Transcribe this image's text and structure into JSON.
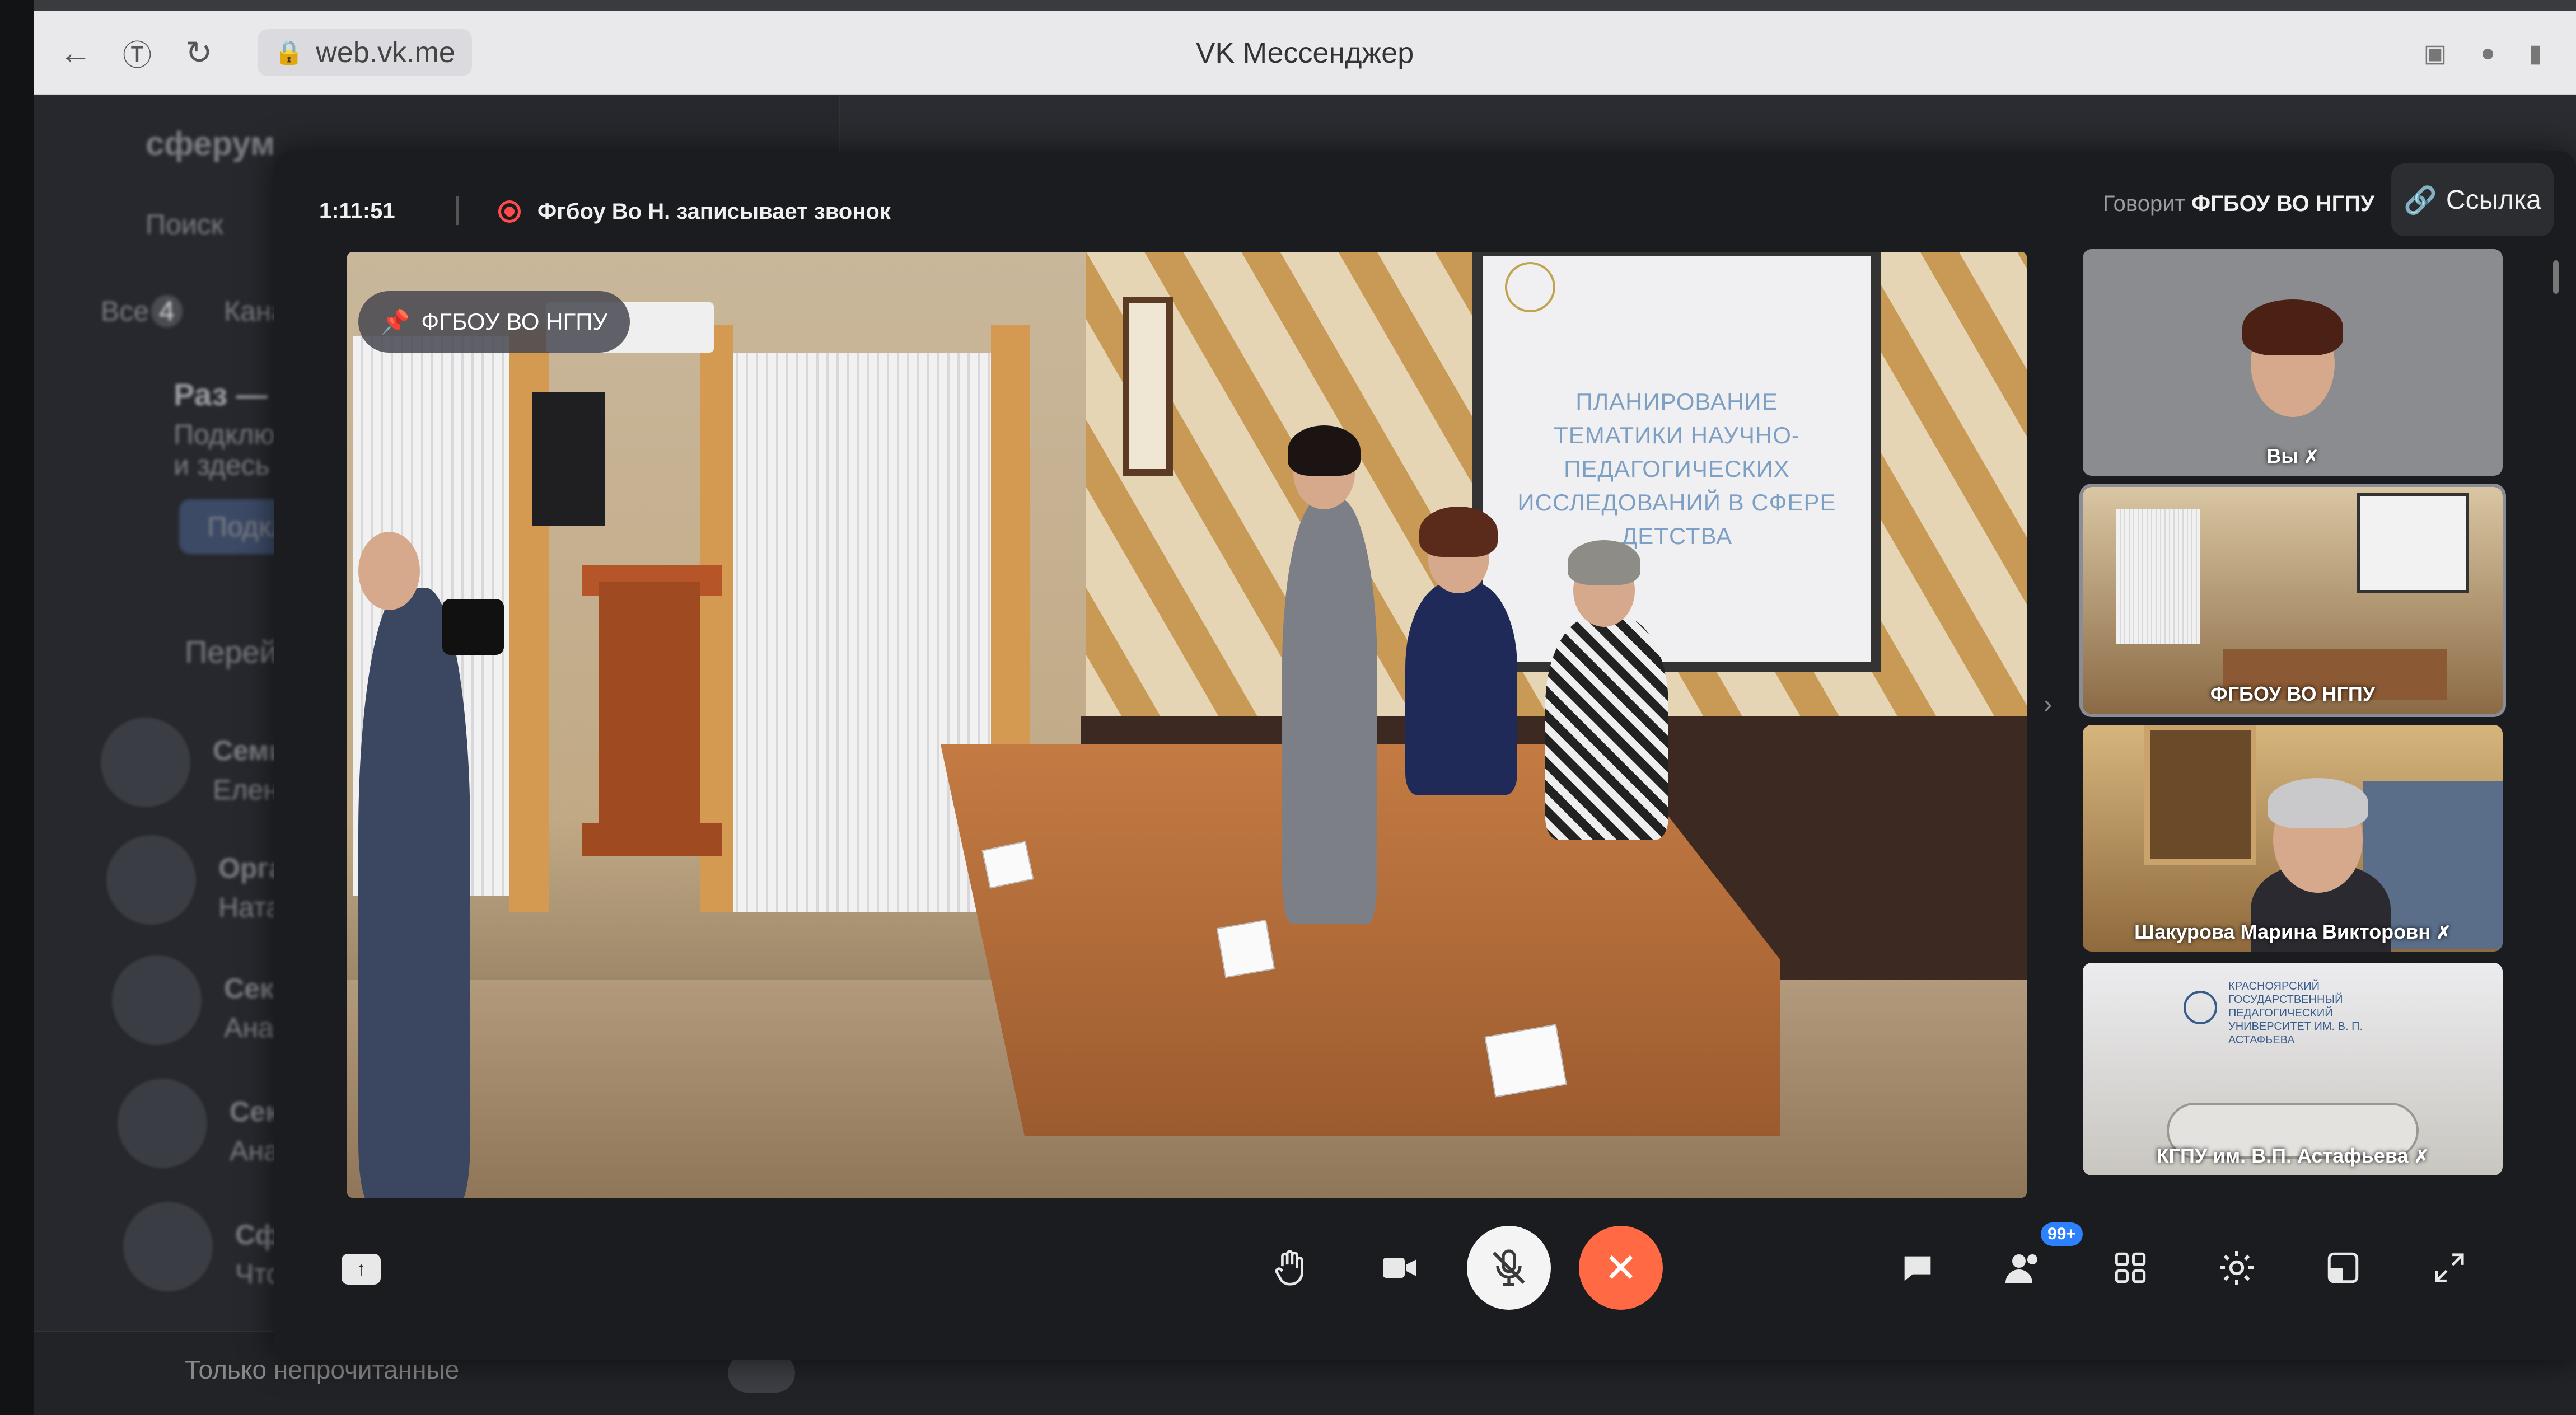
{
  "browser": {
    "title": "VK Мессенджер",
    "url": "web.vk.me"
  },
  "background_app": {
    "brand": "сферум",
    "search_ghost": "Поиск",
    "tab_all": "Все",
    "tab_all_count": "4",
    "tab_channels": "Кана",
    "promo_title": "Раз — и",
    "promo_line1": "Подклю",
    "promo_line2": "и здесь",
    "promo_button": "Подкл",
    "goto": "Перейт",
    "chats": [
      {
        "title": "Семин",
        "sub": "Елена"
      },
      {
        "title": "Орган",
        "sub": "Натал"
      },
      {
        "title": "Секци",
        "sub": "Анаст"
      },
      {
        "title": "Секци",
        "sub": "Анаст"
      },
      {
        "title": "Сферу",
        "sub": "Чтобы"
      }
    ],
    "unread_only": "Только непрочитанные"
  },
  "call": {
    "timer": "1:11:51",
    "recording_text": "Фгбоу Во Н. записывает звонок",
    "speaker_prefix": "Говорит",
    "speaker_name": "ФГБОУ ВО НГПУ",
    "link_label": "Ссылка",
    "pinned_label": "ФГБОУ ВО НГПУ",
    "slide": {
      "title": "ПЛАНИРОВАНИЕ ТЕМАТИКИ НАУЧНО-ПЕДАГОГИЧЕСКИХ ИССЛЕДОВАНИЙ В СФЕРЕ ДЕТСТВА"
    },
    "participants": [
      {
        "name": "Вы",
        "muted": true,
        "active": false
      },
      {
        "name": "ФГБОУ ВО НГПУ",
        "muted": false,
        "active": true
      },
      {
        "name": "Шакурова Марина Викторовн",
        "muted": true,
        "active": false
      },
      {
        "name": "КГПУ им. В.П. Астафьева",
        "muted": true,
        "active": false
      }
    ],
    "participants_badge": "99+",
    "thumb4_banner": "КРАСНОЯРСКИЙ ГОСУДАРСТВЕННЫЙ ПЕДАГОГИЧЕСКИЙ УНИВЕРСИТЕТ ИМ. В. П. АСТАФЬЕВА"
  },
  "controls": {
    "icons": [
      "hand-icon",
      "camera-icon",
      "mic-off-icon",
      "hangup-icon",
      "chat-icon",
      "participants-icon",
      "grid-icon",
      "settings-icon",
      "layout-icon",
      "fullscreen-icon",
      "share-screen-icon"
    ]
  },
  "colors": {
    "hangup": "#ff6a45",
    "recording": "#ff4b4b",
    "badge": "#2d81ff"
  }
}
